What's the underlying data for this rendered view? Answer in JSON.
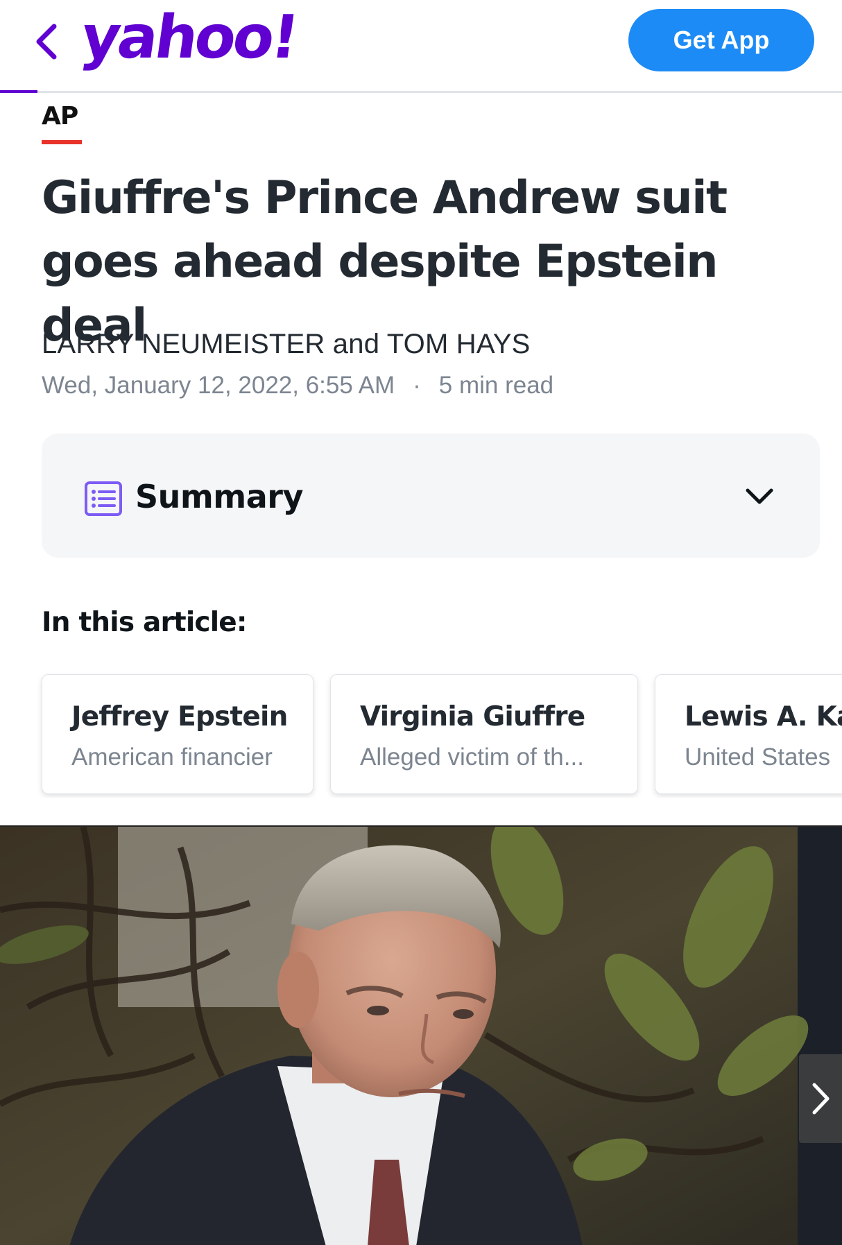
{
  "header": {
    "logo_text": "yahoo!",
    "get_app_label": "Get App",
    "brand_color": "#6001d2",
    "button_color": "#1d8bf5"
  },
  "article": {
    "source": "AP",
    "headline": "Giuffre's Prince Andrew suit goes ahead despite Epstein deal",
    "byline": "LARRY NEUMEISTER and TOM HAYS",
    "date": "Wed, January 12, 2022, 6:55 AM",
    "separator": "·",
    "read_time": "5 min read"
  },
  "summary": {
    "label": "Summary",
    "icon": "list-icon",
    "toggle_icon": "chevron-down-icon"
  },
  "in_article": {
    "heading": "In this article:",
    "cards": [
      {
        "name": "Jeffrey Epstein",
        "desc": "American financier"
      },
      {
        "name": "Virginia Giuffre",
        "desc": "Alleged victim of th..."
      },
      {
        "name": "Lewis A. Kaplan",
        "desc": "United States"
      }
    ]
  },
  "photo": {
    "next_icon": "chevron-right-icon"
  }
}
